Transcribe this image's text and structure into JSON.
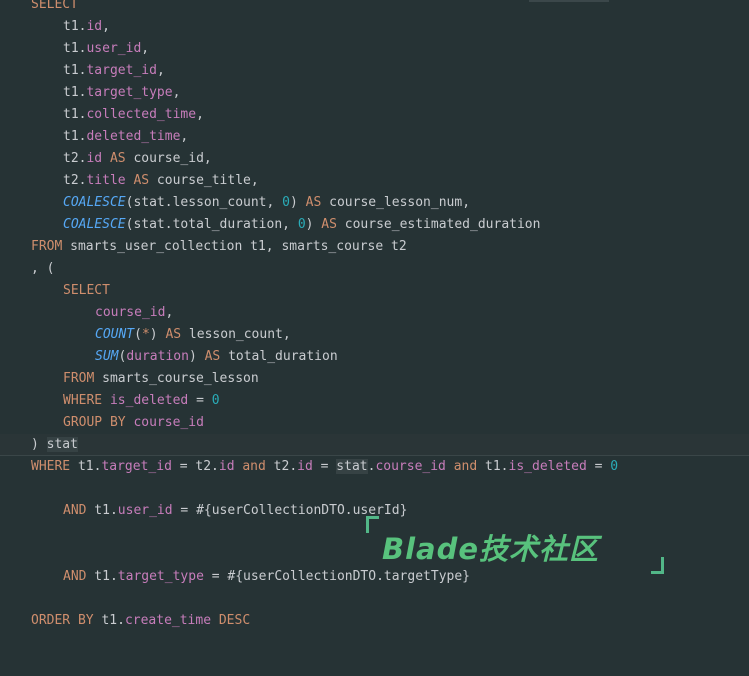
{
  "editor": {
    "lines": [
      "SELECT",
      "t1.id,",
      "t1.user_id,",
      "t1.target_id,",
      "t1.target_type,",
      "t1.collected_time,",
      "t1.deleted_time,",
      "t2.id AS course_id,",
      "t2.title AS course_title,",
      "COALESCE(stat.lesson_count, 0) AS course_lesson_num,",
      "COALESCE(stat.total_duration, 0) AS course_estimated_duration",
      "FROM smarts_user_collection t1, smarts_course t2",
      ", (",
      "SELECT",
      "course_id,",
      "COUNT(*) AS lesson_count,",
      "SUM(duration) AS total_duration",
      "FROM smarts_course_lesson",
      "WHERE is_deleted = 0",
      "GROUP BY course_id",
      ") stat",
      "WHERE t1.target_id = t2.id and t2.id = stat.course_id and t1.is_deleted = 0",
      "AND t1.user_id = #{userCollectionDTO.userId}",
      "AND t1.target_type = #{userCollectionDTO.targetType}",
      "ORDER BY t1.create_time DESC"
    ]
  },
  "watermark": {
    "text": "Blade技术社区",
    "color": "#58c27d"
  }
}
